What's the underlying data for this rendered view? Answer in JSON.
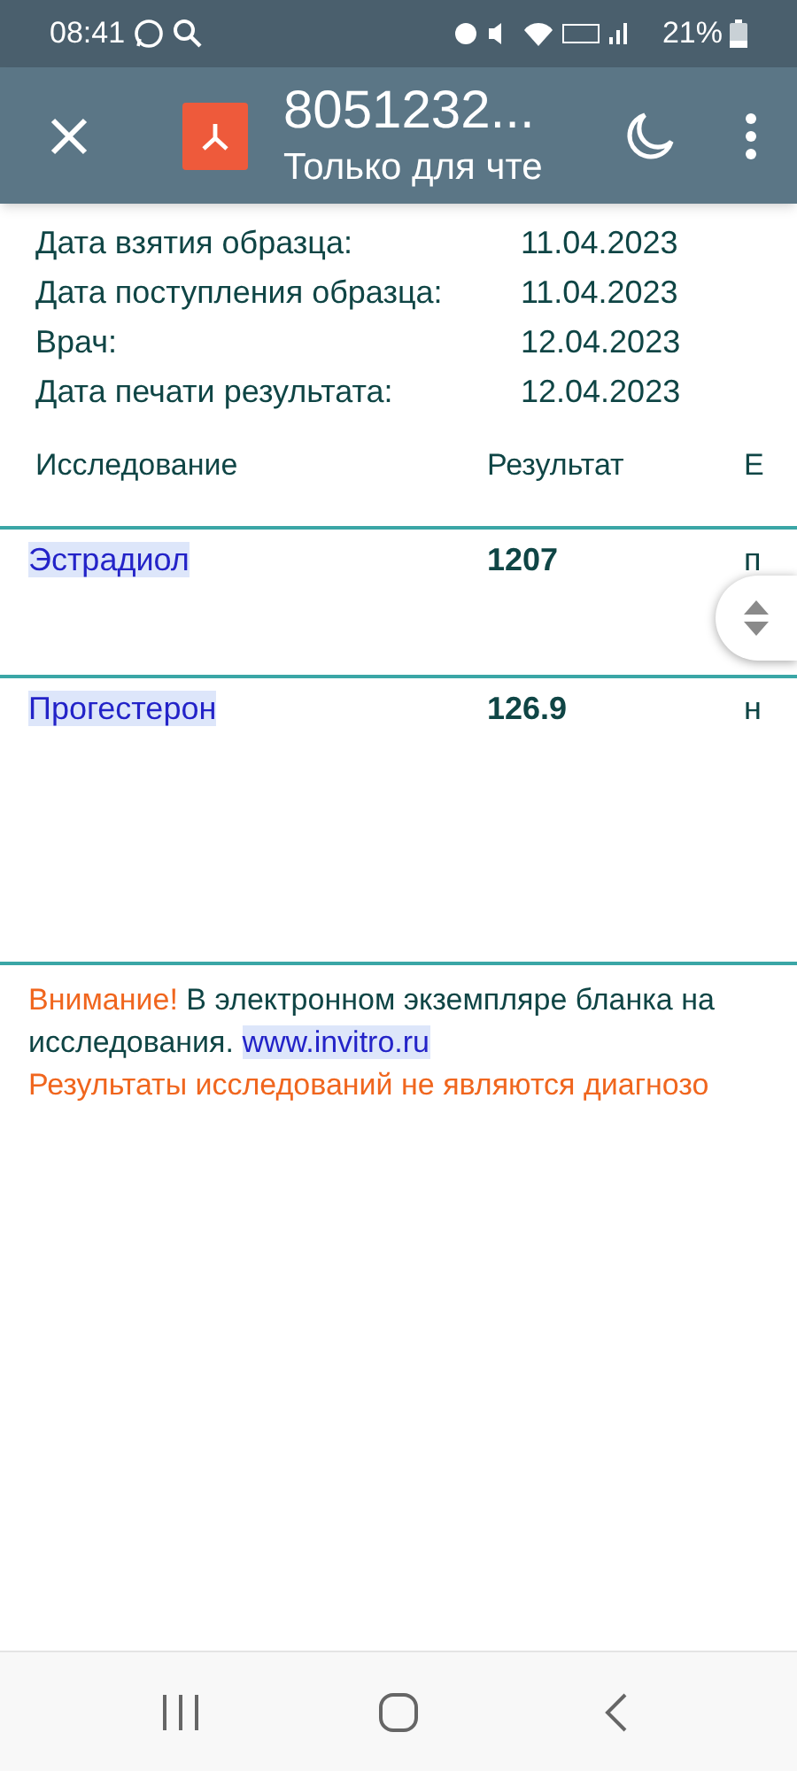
{
  "status_bar": {
    "time": "08:41",
    "battery": "21%"
  },
  "app_bar": {
    "title": "8051232...",
    "subtitle": "Только для чте"
  },
  "details": [
    {
      "label": "Дата взятия образца:",
      "value": "11.04.2023"
    },
    {
      "label": "Дата поступления образца:",
      "value": "11.04.2023"
    },
    {
      "label": "Врач:",
      "value": "12.04.2023"
    },
    {
      "label": "Дата печати результата:",
      "value": "12.04.2023"
    }
  ],
  "table": {
    "columns": [
      "Исследование",
      "Результат",
      "Е"
    ],
    "rows": [
      {
        "test": "Эстрадиол",
        "result": "1207",
        "unit": "п"
      },
      {
        "test": "Прогестерон",
        "result": "126.9",
        "unit": "н"
      }
    ]
  },
  "notice": {
    "warning": "Внимание!",
    "text": "В электронном экземпляре бланка на",
    "continuation": "исследования.",
    "link": "www.invitro.ru",
    "disclaimer": "Результаты исследований не являются диагнозо"
  }
}
